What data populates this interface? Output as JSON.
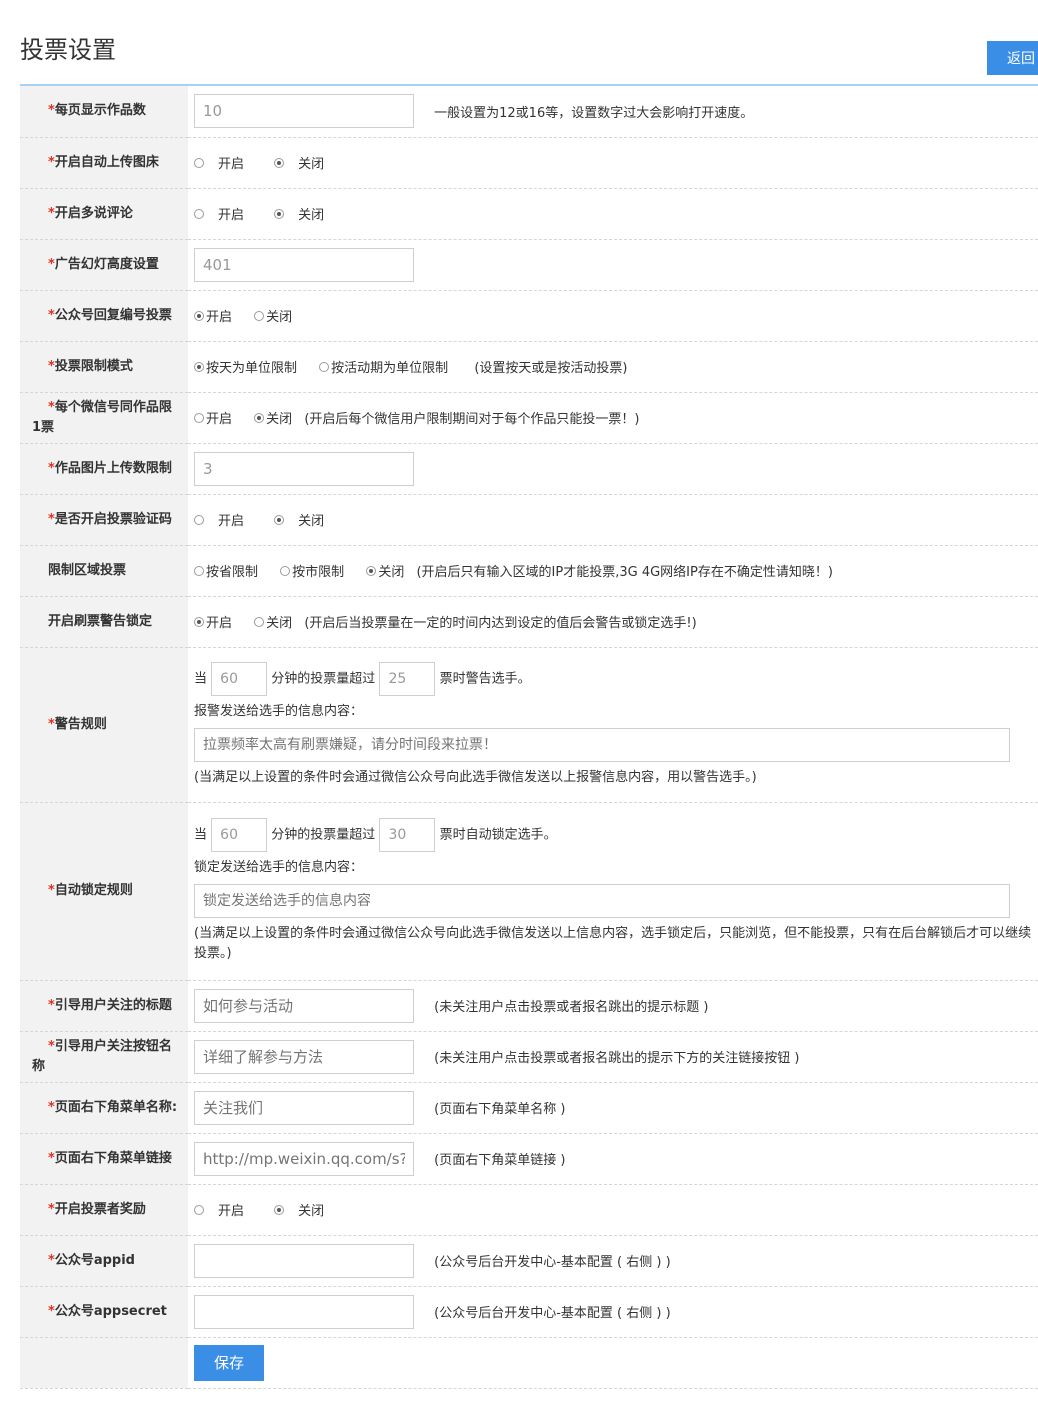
{
  "header": {
    "title": "投票设置",
    "back_label": "返回"
  },
  "rows": {
    "per_page": {
      "label": "每页显示作品数",
      "value": "10",
      "hint": "一般设置为12或16等，设置数字过大会影响打开速度。"
    },
    "auto_upload": {
      "label": "开启自动上传图床",
      "opt_on": "开启",
      "opt_off": "关闭",
      "selected": "off"
    },
    "duoshuo": {
      "label": "开启多说评论",
      "opt_on": "开启",
      "opt_off": "关闭",
      "selected": "off"
    },
    "ad_height": {
      "label": "广告幻灯高度设置",
      "value": "401"
    },
    "mp_reply": {
      "label": "公众号回复编号投票",
      "opt_on": "开启",
      "opt_off": "关闭",
      "selected": "on"
    },
    "vote_limit_mode": {
      "label": "投票限制模式",
      "opt_day": "按天为单位限制",
      "opt_period": "按活动期为单位限制",
      "hint": "(设置按天或是按活动投票)",
      "selected": "day"
    },
    "one_per_work": {
      "label": "每个微信号同作品限1票",
      "opt_on": "开启",
      "opt_off": "关闭",
      "hint": "(开启后每个微信用户限制期间对于每个作品只能投一票！)",
      "selected": "off"
    },
    "image_limit": {
      "label": "作品图片上传数限制",
      "value": "3"
    },
    "captcha": {
      "label": "是否开启投票验证码",
      "opt_on": "开启",
      "opt_off": "关闭",
      "selected": "off"
    },
    "region": {
      "label": "限制区域投票",
      "opt_province": "按省限制",
      "opt_city": "按市限制",
      "opt_off": "关闭",
      "hint": "(开启后只有输入区域的IP才能投票,3G 4G网络IP存在不确定性请知晓！)",
      "selected": "off"
    },
    "brush_lock": {
      "label": "开启刷票警告锁定",
      "opt_on": "开启",
      "opt_off": "关闭",
      "hint": "(开启后当投票量在一定的时间内达到设定的值后会警告或锁定选手!)",
      "selected": "on"
    },
    "warn_rule": {
      "label": "警告规则",
      "prefix": "当",
      "minutes": "60",
      "mid": "分钟的投票量超过",
      "votes": "25",
      "suffix": "票时警告选手。",
      "msg_label": "报警发送给选手的信息内容：",
      "msg_placeholder": "拉票频率太高有刷票嫌疑，请分时间段来拉票！",
      "note": "(当满足以上设置的条件时会通过微信公众号向此选手微信发送以上报警信息内容，用以警告选手。)"
    },
    "lock_rule": {
      "label": "自动锁定规则",
      "prefix": "当",
      "minutes": "60",
      "mid": "分钟的投票量超过",
      "votes": "30",
      "suffix": "票时自动锁定选手。",
      "msg_label": "锁定发送给选手的信息内容：",
      "msg_placeholder": "锁定发送给选手的信息内容",
      "note": "(当满足以上设置的条件时会通过微信公众号向此选手微信发送以上信息内容，选手锁定后，只能浏览，但不能投票，只有在后台解锁后才可以继续投票。)"
    },
    "follow_title": {
      "label": "引导用户关注的标题",
      "placeholder": "如何参与活动",
      "hint": "(未关注用户点击投票或者报名跳出的提示标题 )"
    },
    "follow_button": {
      "label": "引导用户关注按钮名称",
      "placeholder": "详细了解参与方法",
      "hint": "(未关注用户点击投票或者报名跳出的提示下方的关注链接按钮 )"
    },
    "menu_name": {
      "label": "页面右下角菜单名称:",
      "placeholder": "关注我们",
      "hint": "(页面右下角菜单名称 )"
    },
    "menu_link": {
      "label": "页面右下角菜单链接",
      "placeholder": "http://mp.weixin.qq.com/s?__",
      "hint": "(页面右下角菜单链接 )"
    },
    "voter_reward": {
      "label": "开启投票者奖励",
      "opt_on": "开启",
      "opt_off": "关闭",
      "selected": "off"
    },
    "appid": {
      "label": "公众号appid",
      "value": "",
      "hint": "(公众号后台开发中心-基本配置 ( 右侧 ) )"
    },
    "appsecret": {
      "label": "公众号appsecret",
      "value": "",
      "hint": "(公众号后台开发中心-基本配置 ( 右侧 ) )"
    }
  },
  "footer": {
    "save_label": "保存"
  },
  "colors": {
    "accent": "#3a8ee6",
    "required_star": "#e0311f"
  }
}
